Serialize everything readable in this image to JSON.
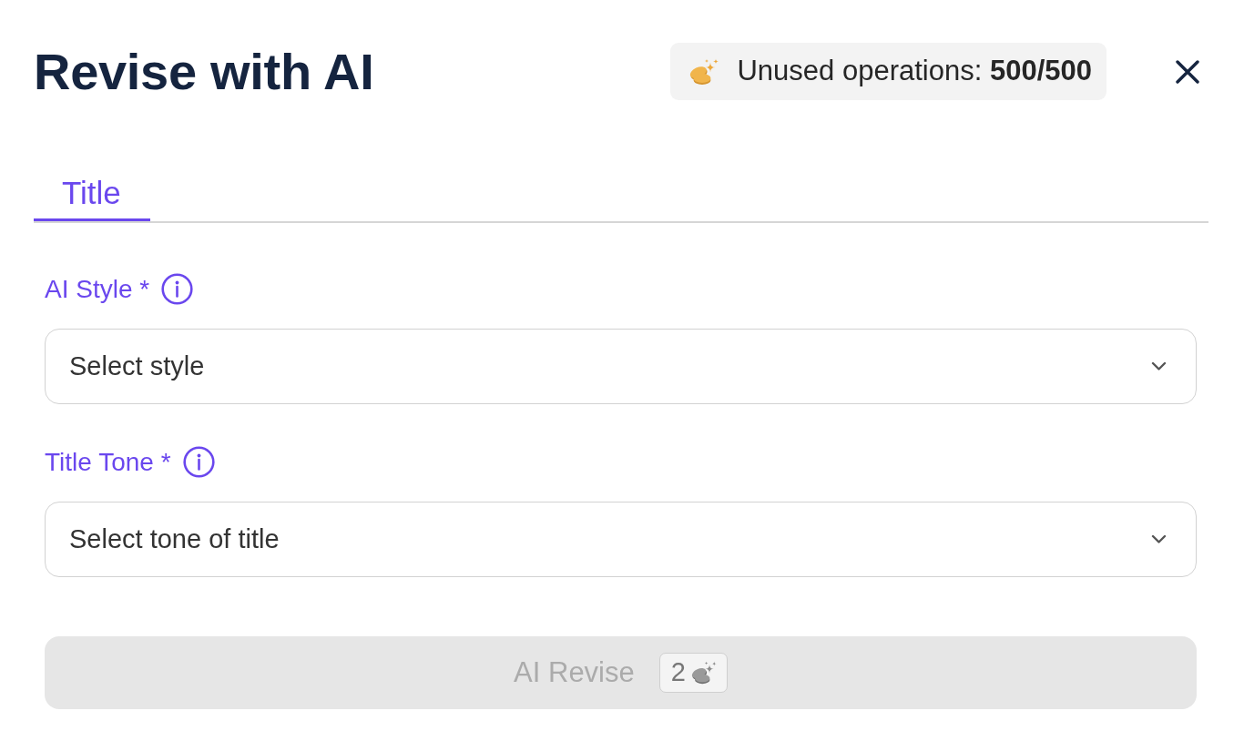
{
  "header": {
    "title": "Revise with AI",
    "operations": "Unused operations: **500/500**"
  },
  "tabs": [
    {
      "label": "Title",
      "selected": true
    }
  ],
  "fields": [
    {
      "label": "AI Style *",
      "placeholder": "Select style"
    },
    {
      "label": "Title Tone *",
      "placeholder": "Select tone of title"
    }
  ],
  "submit": {
    "label": "AI Revise",
    "cost": "2",
    "disabled": true
  }
}
